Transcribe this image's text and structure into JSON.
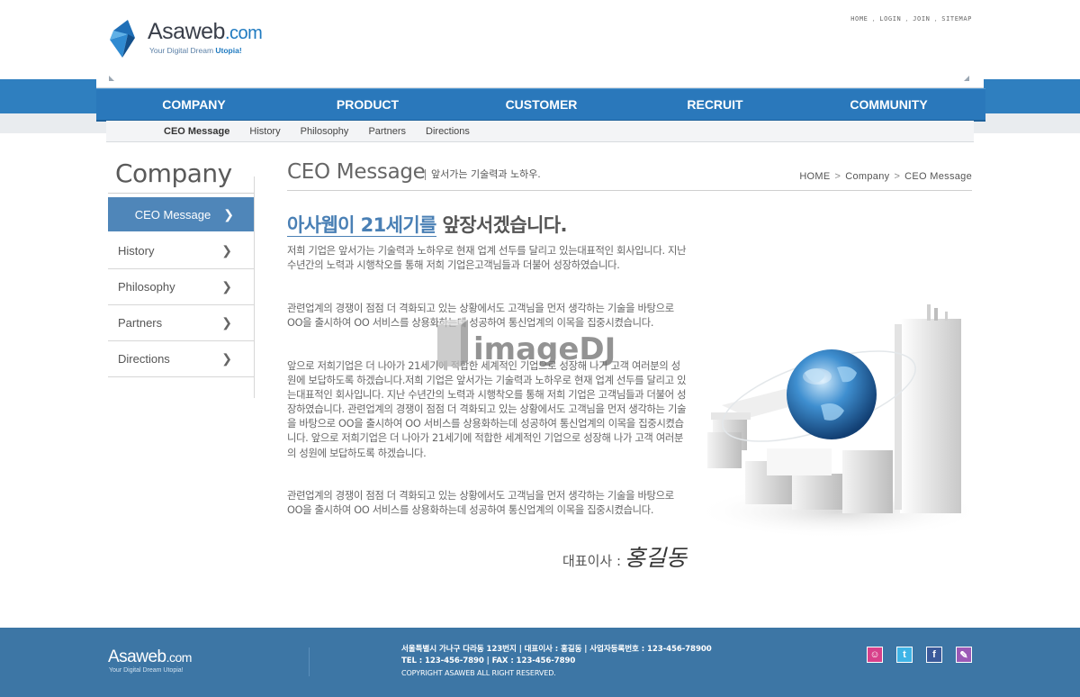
{
  "brand": {
    "name": "Asaweb",
    "domain": ".com",
    "tagline_prefix": "Your Digital Dream ",
    "tagline_highlight": "Utopia!",
    "accent_color": "#2a78bb"
  },
  "top_links": [
    "HOME",
    "LOGIN",
    "JOIN",
    "SITEMAP"
  ],
  "nav": {
    "items": [
      "COMPANY",
      "PRODUCT",
      "CUSTOMER",
      "RECRUIT",
      "COMMUNITY"
    ]
  },
  "subnav": {
    "items": [
      "CEO Message",
      "History",
      "Philosophy",
      "Partners",
      "Directions"
    ],
    "active": "CEO Message"
  },
  "sidebar": {
    "title": "Company",
    "items": [
      {
        "label": "CEO Message",
        "active": true
      },
      {
        "label": "History",
        "active": false
      },
      {
        "label": "Philosophy",
        "active": false
      },
      {
        "label": "Partners",
        "active": false
      },
      {
        "label": "Directions",
        "active": false
      }
    ]
  },
  "content": {
    "title": "CEO Message",
    "subtitle": "앞서가는 기술력과 노하우.",
    "breadcrumb": [
      "HOME",
      "Company",
      "CEO Message"
    ],
    "headline_highlight": "아사웹이 21세기를",
    "headline_rest": " 앞장서겠습니다.",
    "paragraphs": [
      "저희 기업은 앞서가는 기술력과 노하우로 현재 업계 선두를 달리고 있는대표적인 회사입니다. 지난 수년간의 노력과 시행착오를 통해 저희 기업은고객님들과 더불어 성장하였습니다.",
      "관련업계의 경쟁이 점점 더 격화되고 있는 상황에서도 고객님을 먼저 생각하는 기술을 바탕으로 OO을 출시하여 OO 서비스를 상용화하는데 성공하여 통신업계의 이목을 집중시켰습니다.",
      "앞으로 저희기업은 더 나아가 21세기에 적합한 세계적인 기업으로 성장해 나가 고객 여러분의 성원에 보답하도록 하겠습니다.저희 기업은 앞서가는 기술력과 노하우로 현재 업계 선두를 달리고 있는대표적인 회사입니다. 지난 수년간의 노력과 시행착오를 통해 저희 기업은 고객님들과 더불어 성장하였습니다. 관련업계의 경쟁이 점점 더 격화되고 있는 상황에서도 고객님을 먼저 생각하는 기술을 바탕으로 OO을 출시하여 OO 서비스를 상용화하는데 성공하여 통신업계의 이목을 집중시켰습니다. 앞으로 저희기업은 더 나아가 21세기에 적합한 세계적인 기업으로 성장해 나가 고객 여러분의 성원에 보답하도록 하겠습니다.",
      "관련업계의 경쟁이 점점 더 격화되고 있는 상황에서도 고객님을 먼저 생각하는 기술을 바탕으로 OO을 출시하여 OO 서비스를 상용화하는데 성공하여 통신업계의 이목을 집중시켰습니다."
    ],
    "signature_label": "대표이사 :",
    "signature_name": "홍길동"
  },
  "watermark": "imageDJ",
  "footer": {
    "logo_name": "Asaweb",
    "logo_domain": ".com",
    "tagline": "Your Digital Dream Utopia!",
    "address_line": "서울특별시 가나구 다라동 123번지  |  대표이사 : 홍길동  |  사업자등록번호 : 123-456-78900",
    "contact_line": "TEL : 123-456-7890  |  FAX : 123-456-7890",
    "copyright": "COPYRIGHT ASAWEB ALL RIGHT RESERVED.",
    "background_color": "#3d76a5"
  },
  "sns": [
    {
      "icon": "me2day-icon",
      "glyph": "☺",
      "color": "#d8408a"
    },
    {
      "icon": "twitter-icon",
      "glyph": "t",
      "color": "#3fb4e6"
    },
    {
      "icon": "facebook-icon",
      "glyph": "f",
      "color": "#3b5a9a"
    },
    {
      "icon": "blog-icon",
      "glyph": "✎",
      "color": "#9b59b6"
    }
  ]
}
